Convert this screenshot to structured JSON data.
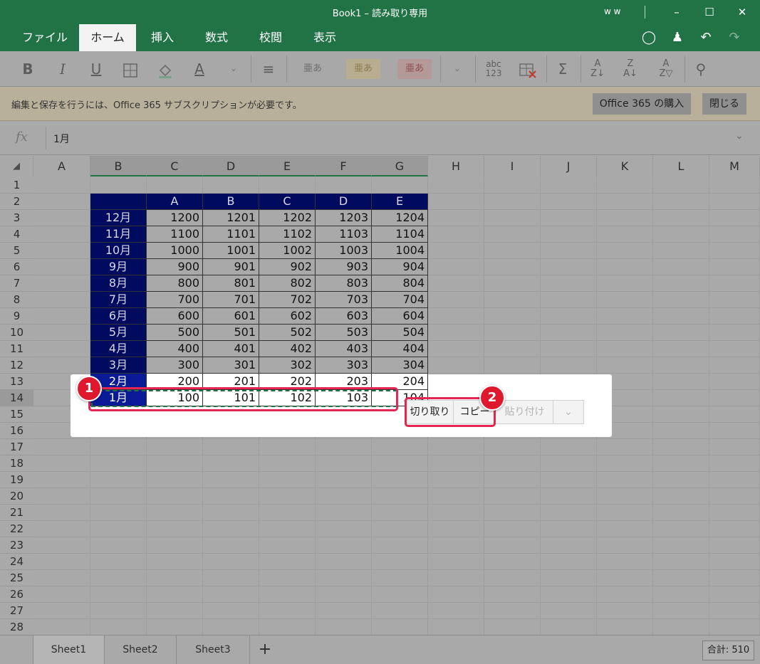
{
  "titlebar": {
    "title": "Book1 – 読み取り専用",
    "user": "w w"
  },
  "tabs": [
    "ファイル",
    "ホーム",
    "挿入",
    "数式",
    "校閲",
    "表示"
  ],
  "ribbon": {
    "styles": [
      "亜あ",
      "亜あ",
      "亜あ"
    ],
    "numformat_top": "abc",
    "numformat_bottom": "123"
  },
  "notice": {
    "message": "編集と保存を行うには、Office 365 サブスクリプションが必要です。",
    "buy": "Office 365 の購入",
    "close": "閉じる"
  },
  "formula": {
    "fx": "fx",
    "value": "1月"
  },
  "columns": [
    "A",
    "B",
    "C",
    "D",
    "E",
    "F",
    "G",
    "H",
    "I",
    "J",
    "K",
    "L",
    "M"
  ],
  "rows": [
    "1",
    "2",
    "3",
    "4",
    "5",
    "6",
    "7",
    "8",
    "9",
    "10",
    "11",
    "12",
    "13",
    "14",
    "15",
    "16",
    "17",
    "18",
    "19",
    "20",
    "21",
    "22",
    "23",
    "24",
    "25",
    "26",
    "27",
    "28"
  ],
  "table": {
    "headers": [
      "A",
      "B",
      "C",
      "D",
      "E"
    ],
    "row_labels": [
      "12月",
      "11月",
      "10月",
      "9月",
      "8月",
      "7月",
      "6月",
      "5月",
      "4月",
      "3月",
      "2月",
      "1月"
    ],
    "values": [
      [
        "1200",
        "1201",
        "1202",
        "1203",
        "1204"
      ],
      [
        "1100",
        "1101",
        "1102",
        "1103",
        "1104"
      ],
      [
        "1000",
        "1001",
        "1002",
        "1003",
        "1004"
      ],
      [
        "900",
        "901",
        "902",
        "903",
        "904"
      ],
      [
        "800",
        "801",
        "802",
        "803",
        "804"
      ],
      [
        "700",
        "701",
        "702",
        "703",
        "704"
      ],
      [
        "600",
        "601",
        "602",
        "603",
        "604"
      ],
      [
        "500",
        "501",
        "502",
        "503",
        "504"
      ],
      [
        "400",
        "401",
        "402",
        "403",
        "404"
      ],
      [
        "300",
        "301",
        "302",
        "303",
        "304"
      ],
      [
        "200",
        "201",
        "202",
        "203",
        "204"
      ],
      [
        "100",
        "101",
        "102",
        "103",
        "104"
      ]
    ]
  },
  "context_menu": {
    "cut": "切り取り",
    "copy": "コピー",
    "paste": "貼り付け"
  },
  "badges": [
    "1",
    "2"
  ],
  "sheets": [
    "Sheet1",
    "Sheet2",
    "Sheet3"
  ],
  "add_sheet": "+",
  "status": "合計: 510",
  "colors": {
    "accent": "#217346",
    "header_blue": "#000a5e",
    "badge": "#e0182e"
  }
}
